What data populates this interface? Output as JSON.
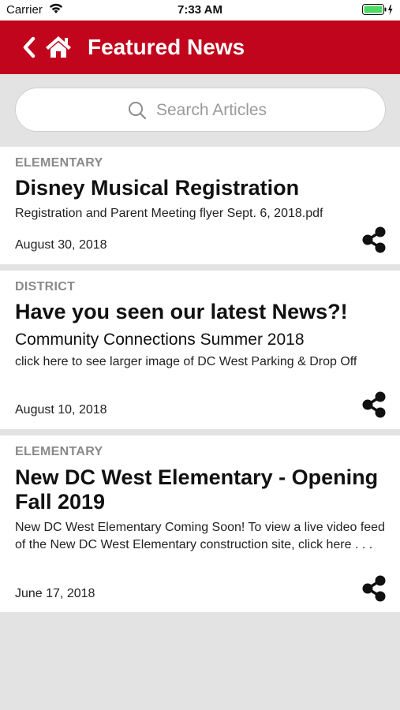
{
  "status": {
    "carrier": "Carrier",
    "time": "7:33 AM"
  },
  "nav": {
    "title": "Featured News"
  },
  "search": {
    "placeholder": "Search Articles"
  },
  "colors": {
    "brand": "#c0051c",
    "background": "#e3e3e3",
    "category": "#8a8a8a"
  },
  "articles": [
    {
      "category": "ELEMENTARY",
      "headline": "Disney Musical Registration",
      "body": "Registration and Parent Meeting flyer Sept. 6, 2018.pdf",
      "date": "August 30, 2018"
    },
    {
      "category": "DISTRICT",
      "headline": "Have you seen our latest News?!",
      "subhead": "Community Connections Summer 2018",
      "body": "click here to see larger image of DC West Parking & Drop Off",
      "date": "August 10, 2018"
    },
    {
      "category": "ELEMENTARY",
      "headline": "New DC West Elementary - Opening Fall 2019",
      "body": "New DC West Elementary Coming Soon!      To view a live video feed of the New DC West Elementary construction site, click here   . . .",
      "date": "June 17, 2018"
    }
  ]
}
